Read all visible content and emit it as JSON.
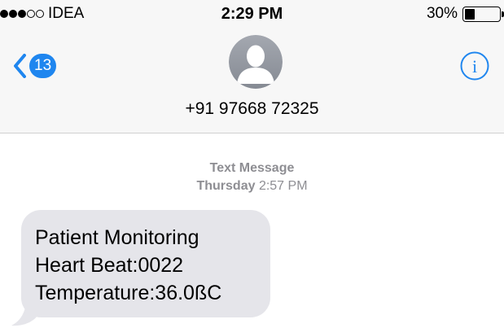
{
  "status_bar": {
    "signal_filled": 3,
    "signal_total": 5,
    "carrier": "IDEA",
    "time": "2:29 PM",
    "battery_percent_label": "30%",
    "battery_level": 0.3
  },
  "nav": {
    "back_icon": "chevron-left-icon",
    "unread_count": "13",
    "contact": "+91 97668 72325",
    "avatar_icon": "person-silhouette-icon",
    "info_icon": "info-icon"
  },
  "conversation": {
    "message_type": "Text Message",
    "date_day": "Thursday",
    "date_time": "2:57 PM",
    "messages": [
      {
        "direction": "incoming",
        "lines": [
          "Patient Monitoring",
          "Heart Beat:0022",
          "Temperature:36.0ßC"
        ]
      }
    ]
  },
  "colors": {
    "accent": "#1f86ef",
    "bubble_incoming": "#e5e5ea",
    "header_bg": "#f7f7f7",
    "meta_text": "#8e8e93"
  }
}
